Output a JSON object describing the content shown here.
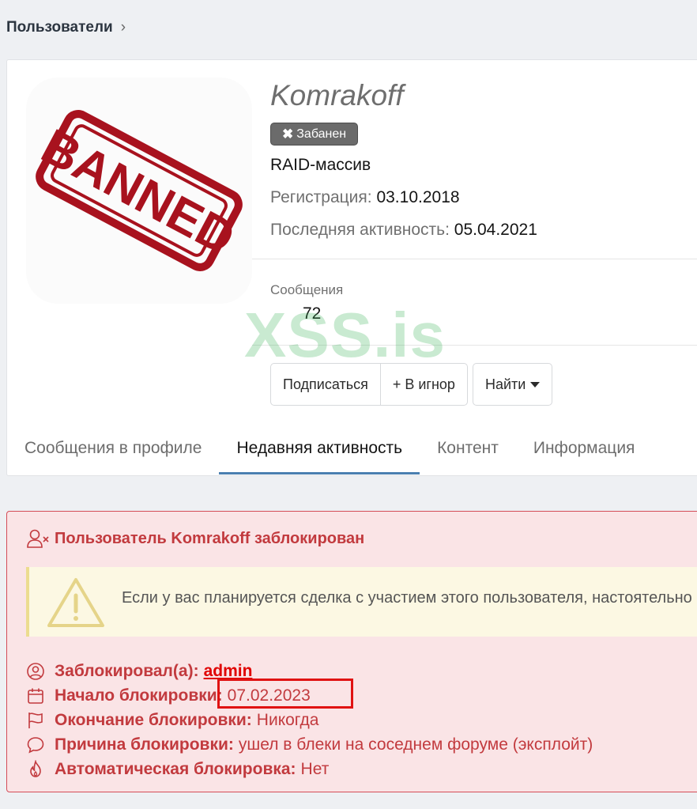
{
  "breadcrumb": {
    "item": "Пользователи"
  },
  "profile": {
    "avatar_stamp": "BANNED",
    "username": "Komrakoff",
    "ban_badge": "Забанен",
    "user_title": "RAID-массив",
    "registration_label": "Регистрация:",
    "registration_value": "03.10.2018",
    "last_activity_label": "Последняя активность:",
    "last_activity_value": "05.04.2021",
    "stats": {
      "messages_label": "Сообщения",
      "messages_value": "72"
    },
    "watermark": "XSS.is",
    "buttons": {
      "subscribe": "Подписаться",
      "ignore": "+ В игнор",
      "find": "Найти"
    }
  },
  "tabs": [
    {
      "label": "Сообщения в профиле",
      "active": false
    },
    {
      "label": "Недавняя активность",
      "active": true
    },
    {
      "label": "Контент",
      "active": false
    },
    {
      "label": "Информация",
      "active": false
    }
  ],
  "ban_block": {
    "title": "Пользователь Komrakoff заблокирован",
    "warning": "Если у вас планируется сделка с участием этого пользователя, настоятельно",
    "banned_by_label": "Заблокировал(а):",
    "banned_by_value": "admin",
    "start_label": "Начало блокировки:",
    "start_value": "07.02.2023",
    "end_label": "Окончание блокировки:",
    "end_value": "Никогда",
    "reason_label": "Причина блокировки:",
    "reason_value": "ушел в блеки на соседнем форуме (эксплойт)",
    "auto_label": "Автоматическая блокировка:",
    "auto_value": "Нет"
  },
  "colors": {
    "ban_text": "#c23a3e",
    "ban_bg": "#fae4e6",
    "link": "#e00000",
    "highlight": "#e01212",
    "tab_underline": "#4a7fb0"
  }
}
